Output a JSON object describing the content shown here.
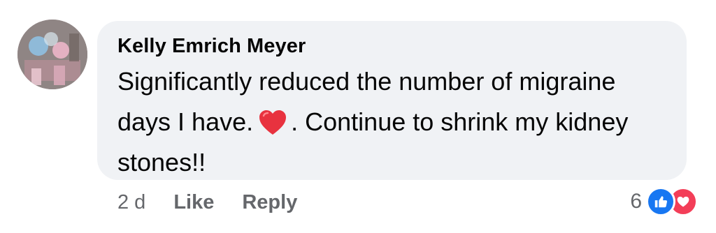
{
  "comment": {
    "author": "Kelly Emrich Meyer",
    "lines": [
      "Significantly reduced the number of migraine",
      "days I have.",
      ". Continue to shrink my kidney",
      "stones!!"
    ],
    "emoji": "heart-emoji"
  },
  "actions": {
    "time": "2 d",
    "like_label": "Like",
    "reply_label": "Reply"
  },
  "reactions": {
    "count": "6",
    "icons": [
      "like-reaction-icon",
      "love-reaction-icon"
    ]
  },
  "colors": {
    "bubble_bg": "#f0f2f5",
    "text": "#050505",
    "secondary_text": "#65676b",
    "like_blue": "#1877f2",
    "love_red": "#f33e58"
  }
}
